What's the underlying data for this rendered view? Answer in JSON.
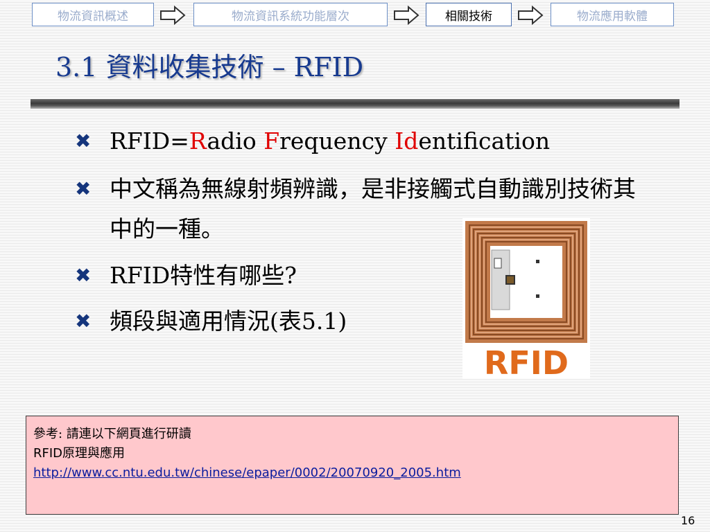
{
  "nav": {
    "items": [
      {
        "label": "物流資訊概述",
        "active": false
      },
      {
        "label": "物流資訊系統功能層次",
        "active": false
      },
      {
        "label": "相關技術",
        "active": true
      },
      {
        "label": "物流應用軟體",
        "active": false
      }
    ],
    "arrow_icon": "arrow-right-icon"
  },
  "title": "3.1 資料收集技術 – RFID",
  "bullets": {
    "icon": "x-bullet-icon",
    "b1": {
      "pre": "RFID=",
      "r": "R",
      "adio": "adio ",
      "f": "F",
      "requency": "requency ",
      "id": "Id",
      "entification": "entification"
    },
    "b2": "中文稱為無線射頻辨識，是非接觸式自動識別技術其中的一種。",
    "b3": "RFID特性有哪些?",
    "b4": "頻段與適用情況(表5.1)"
  },
  "image": {
    "logo_text": "RFID"
  },
  "reference": {
    "label": "參考:",
    "intro": " 請連以下網頁進行研讀",
    "line2": "RFID原理與應用",
    "url": "http://www.cc.ntu.edu.tw/chinese/epaper/0002/20070920_2005.htm"
  },
  "page_number": "16",
  "colors": {
    "title": "#173a8f",
    "accent": "#e00000",
    "ref_bg": "#ffc8cc",
    "nav_border": "#6c8fc6"
  }
}
